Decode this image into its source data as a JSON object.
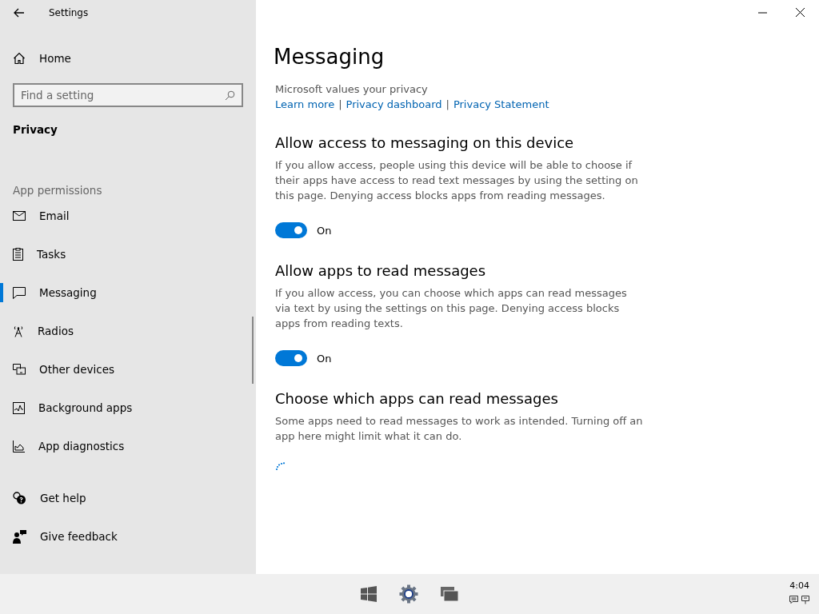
{
  "window": {
    "title": "Settings"
  },
  "sidebar": {
    "home": "Home",
    "search": {
      "placeholder": "Find a setting"
    },
    "section": "Privacy",
    "group": "App permissions",
    "items": [
      {
        "label": "Email",
        "kind": "mail",
        "selected": false
      },
      {
        "label": "Tasks",
        "kind": "tasks",
        "selected": false
      },
      {
        "label": "Messaging",
        "kind": "message",
        "selected": true
      },
      {
        "label": "Radios",
        "kind": "radio",
        "selected": false
      },
      {
        "label": "Other devices",
        "kind": "devices",
        "selected": false
      },
      {
        "label": "Background apps",
        "kind": "background",
        "selected": false
      },
      {
        "label": "App diagnostics",
        "kind": "diagnostics",
        "selected": false
      }
    ],
    "footer": [
      {
        "label": "Get help",
        "kind": "help"
      },
      {
        "label": "Give feedback",
        "kind": "feedback"
      }
    ]
  },
  "page": {
    "title": "Messaging",
    "privacy_note": "Microsoft values your privacy",
    "links": [
      {
        "kind": "link",
        "text": "Learn more"
      },
      {
        "kind": "separator",
        "text": "|"
      },
      {
        "kind": "link",
        "text": "Privacy dashboard"
      },
      {
        "kind": "separator",
        "text": "|"
      },
      {
        "kind": "link",
        "text": "Privacy Statement"
      }
    ],
    "sections": [
      {
        "heading": "Allow access to messaging on this device",
        "description": "If you allow access, people using this device will be able to choose if their apps have access to read text messages by using the setting on this page. Denying access blocks apps from reading messages.",
        "toggle": {
          "on": true,
          "label": "On"
        }
      },
      {
        "heading": "Allow apps to read messages",
        "description": "If you allow access, you can choose which apps can read messages via text by using the settings on this page. Denying access blocks apps from reading texts.",
        "toggle": {
          "on": true,
          "label": "On"
        }
      },
      {
        "heading": "Choose which apps can read messages",
        "description": "Some apps need to read messages to work as intended. Turning off an app here might limit what it can do.",
        "loading": true
      }
    ]
  },
  "taskbar": {
    "clock": "4:04"
  }
}
